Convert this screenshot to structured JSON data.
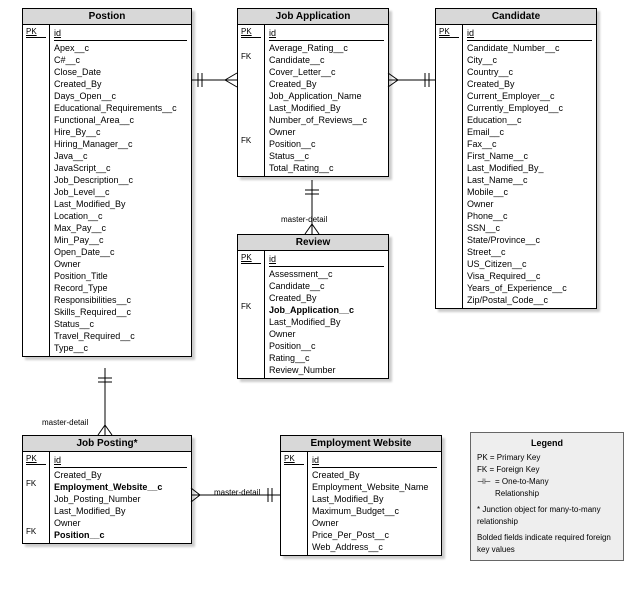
{
  "entities": {
    "position": {
      "title": "Postion",
      "pk": "PK",
      "id": "id",
      "fields": [
        "Apex__c",
        "C#__c",
        "Close_Date",
        "Created_By",
        "Days_Open__c",
        "Educational_Requirements__c",
        "Functional_Area__c",
        "Hire_By__c",
        "Hiring_Manager__c",
        "Java__c",
        "JavaScript__c",
        "Job_Description__c",
        "Job_Level__c",
        "Last_Modified_By",
        "Location__c",
        "Max_Pay__c",
        "Min_Pay__c",
        "Open_Date__c",
        "Owner",
        "Position_Title",
        "Record_Type",
        "Responsibilities__c",
        "Skills_Required__c",
        "Status__c",
        "Travel_Required__c",
        "Type__c"
      ]
    },
    "jobapp": {
      "title": "Job Application",
      "pk": "PK",
      "id": "id",
      "fks": {
        "1": "FK",
        "8": "FK"
      },
      "fields": [
        "Average_Rating__c",
        "Candidate__c",
        "Cover_Letter__c",
        "Created_By",
        "Job_Application_Name",
        "Last_Modified_By",
        "Number_of_Reviews__c",
        "Owner",
        "Position__c",
        "Status__c",
        "Total_Rating__c"
      ]
    },
    "candidate": {
      "title": "Candidate",
      "pk": "PK",
      "id": "id",
      "fields": [
        "Candidate_Number__c",
        "City__c",
        "Country__c",
        "Created_By",
        "Current_Employer__c",
        "Currently_Employed__c",
        "Education__c",
        "Email__c",
        "Fax__c",
        "First_Name__c",
        "Last_Modified_By_",
        "Last_Name__c",
        "Mobile__c",
        "Owner",
        "Phone__c",
        "SSN__c",
        "State/Province__c",
        "Street__c",
        "US_Citizen__c",
        "Visa_Required__c",
        "Years_of_Experience__c",
        "Zip/Postal_Code__c"
      ]
    },
    "review": {
      "title": "Review",
      "pk": "PK",
      "id": "id",
      "fks": {
        "3": "FK"
      },
      "bold": {
        "3": true
      },
      "fields": [
        "Assessment__c",
        "Candidate__c",
        "Created_By",
        "Job_Application__c",
        "Last_Modified_By",
        "Owner",
        "Position__c",
        "Rating__c",
        "Review_Number"
      ]
    },
    "jobposting": {
      "title": "Job Posting*",
      "pk": "PK",
      "id": "id",
      "fks": {
        "1": "FK",
        "5": "FK"
      },
      "bold": {
        "1": true,
        "5": true
      },
      "fields": [
        "Created_By",
        "Employment_Website__c",
        "Job_Posting_Number",
        "Last_Modified_By",
        "Owner",
        "Position__c"
      ]
    },
    "empwebsite": {
      "title": "Employment Website",
      "pk": "PK",
      "id": "id",
      "fields": [
        "Created_By",
        "Employment_Website_Name",
        "Last_Modified_By",
        "Maximum_Budget__c",
        "Owner",
        "Price_Per_Post__c",
        "Web_Address__c"
      ]
    }
  },
  "labels": {
    "md1": "master-detail",
    "md2": "master-detail",
    "md3": "master-detail"
  },
  "legend": {
    "title": "Legend",
    "pk": "PK = Primary Key",
    "fk": "FK = Foreign Key",
    "rel": "= One-to-Many",
    "rel2": "   Relationship",
    "junct": "* Junction object for many-to-many relationship",
    "bold": "Bolded fields indicate required foreign key values"
  }
}
